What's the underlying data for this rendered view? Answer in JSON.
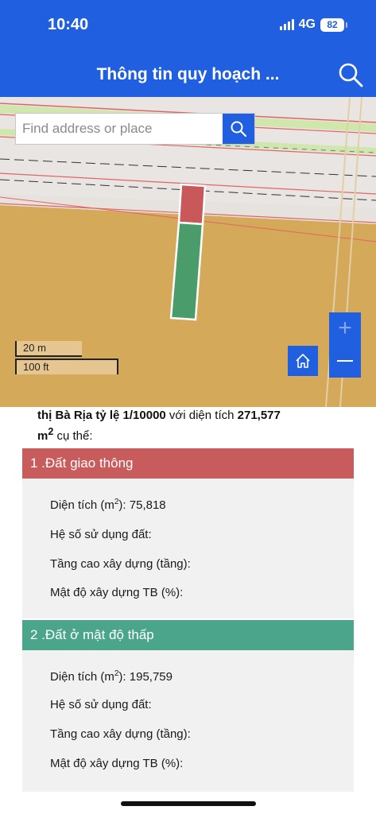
{
  "status_bar": {
    "time": "10:40",
    "network": "4G",
    "battery": "82"
  },
  "header": {
    "title": "Thông tin quy hoạch ...",
    "search_icon": "search-icon"
  },
  "map": {
    "search": {
      "placeholder": "Find address or place",
      "button_icon": "search-icon"
    },
    "scale": {
      "metric": "20 m",
      "imperial": "100 ft"
    },
    "controls": {
      "home_icon": "home-icon",
      "zoom_in": "+",
      "zoom_out_icon": "minus-icon"
    },
    "colors": {
      "road_band": "#cfe7ad",
      "zone_residential": "#d4a95a",
      "parcel_traffic": "#c8585a",
      "parcel_residential": "#4a9c6a"
    }
  },
  "description": {
    "prefix": "thị Bà Rịa tỷ lệ 1/10000",
    "middle": " với diện tích ",
    "area": "271,577",
    "unit": "m",
    "unit_sup": "2",
    "suffix": " cụ thể:"
  },
  "sections": [
    {
      "title": "1 .Đất giao thông",
      "color": "#c85c5c",
      "area_label": "Diện tích (m",
      "area_sup": "2",
      "area_close": "):",
      "area_value": "75,818",
      "land_use_coef": "Hệ số sử dụng đất:",
      "floors": "Tầng cao xây dựng (tầng):",
      "density": "Mật độ xây dựng TB (%):"
    },
    {
      "title": "2 .Đất ở mật độ thấp",
      "color": "#4aa58a",
      "area_label": "Diện tích (m",
      "area_sup": "2",
      "area_close": "):",
      "area_value": "195,759",
      "land_use_coef": "Hệ số sử dụng đất:",
      "floors": "Tầng cao xây dựng (tầng):",
      "density": "Mật độ xây dựng TB (%):"
    }
  ]
}
